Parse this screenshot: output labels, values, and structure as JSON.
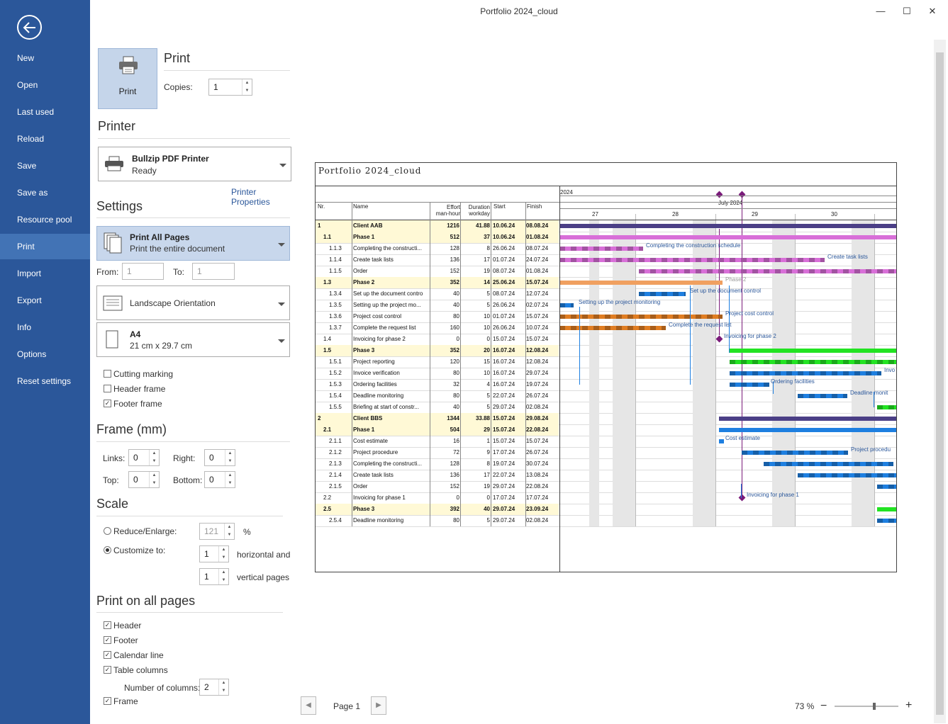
{
  "window": {
    "title": "Portfolio 2024_cloud",
    "minimize": "—",
    "maximize": "☐",
    "close": "✕"
  },
  "sidebar": {
    "items": [
      {
        "label": "New"
      },
      {
        "label": "Open"
      },
      {
        "label": "Last used"
      },
      {
        "label": "Reload"
      },
      {
        "label": "Save"
      },
      {
        "label": "Save as"
      },
      {
        "label": "Resource pool"
      },
      {
        "label": "Print"
      },
      {
        "label": "Import"
      },
      {
        "label": "Export"
      },
      {
        "label": "Info"
      },
      {
        "label": "Options"
      },
      {
        "label": "Reset settings"
      }
    ],
    "active": "Print"
  },
  "print": {
    "button_label": "Print",
    "heading": "Print",
    "copies_label": "Copies:",
    "copies_value": "1"
  },
  "printer": {
    "heading": "Printer",
    "name": "Bullzip PDF Printer",
    "status": "Ready",
    "properties_link": "Printer Properties"
  },
  "settings": {
    "heading": "Settings",
    "pages_title": "Print All Pages",
    "pages_sub": "Print the entire document",
    "from_label": "From:",
    "from_value": "1",
    "to_label": "To:",
    "to_value": "1",
    "orientation": "Landscape Orientation",
    "paper_title": "A4",
    "paper_sub": "21 cm x 29.7 cm",
    "cutting_marking": {
      "label": "Cutting marking",
      "checked": false
    },
    "header_frame": {
      "label": "Header frame",
      "checked": false
    },
    "footer_frame": {
      "label": "Footer frame",
      "checked": true
    }
  },
  "frame": {
    "heading": "Frame (mm)",
    "links_label": "Links:",
    "links_value": "0",
    "right_label": "Right:",
    "right_value": "0",
    "top_label": "Top:",
    "top_value": "0",
    "bottom_label": "Bottom:",
    "bottom_value": "0"
  },
  "scale": {
    "heading": "Scale",
    "reduce_label": "Reduce/Enlarge:",
    "reduce_value": "121",
    "percent": "%",
    "customize_label": "Customize to:",
    "horizontal_value": "1",
    "horizontal_label": "horizontal and",
    "vertical_value": "1",
    "vertical_label": "vertical pages",
    "mode": "customize"
  },
  "all_pages": {
    "heading": "Print on all pages",
    "header": {
      "label": "Header",
      "checked": true
    },
    "footer": {
      "label": "Footer",
      "checked": true
    },
    "calendar_line": {
      "label": "Calendar line",
      "checked": true
    },
    "table_columns": {
      "label": "Table columns",
      "checked": true
    },
    "number_of_columns_label": "Number of columns:",
    "number_of_columns_value": "2",
    "frame": {
      "label": "Frame",
      "checked": true
    }
  },
  "preview": {
    "page_title": "Portfolio 2024_cloud",
    "year": "2024",
    "month": "July 2024",
    "weeks": [
      "27",
      "28",
      "29",
      "30"
    ],
    "columns": {
      "nr": "Nr.",
      "name": "Name",
      "effort1": "Effort",
      "effort2": "man-hour",
      "duration1": "Duration",
      "duration2": "workday",
      "start": "Start",
      "finish": "Finish"
    },
    "rows": [
      {
        "nr": "1",
        "name": "Client AAB",
        "effort": "1216",
        "duration": "41.88",
        "start": "10.06.24",
        "finish": "08.08.24",
        "bold": true
      },
      {
        "nr": "1.1",
        "name": "Phase 1",
        "effort": "512",
        "duration": "37",
        "start": "10.06.24",
        "finish": "01.08.24",
        "bold": true
      },
      {
        "nr": "1.1.3",
        "name": "Completing the constructi...",
        "effort": "128",
        "duration": "8",
        "start": "26.06.24",
        "finish": "08.07.24"
      },
      {
        "nr": "1.1.4",
        "name": "Create task lists",
        "effort": "136",
        "duration": "17",
        "start": "01.07.24",
        "finish": "24.07.24"
      },
      {
        "nr": "1.1.5",
        "name": "Order",
        "effort": "152",
        "duration": "19",
        "start": "08.07.24",
        "finish": "01.08.24"
      },
      {
        "nr": "1.3",
        "name": "Phase 2",
        "effort": "352",
        "duration": "14",
        "start": "25.06.24",
        "finish": "15.07.24",
        "bold": true
      },
      {
        "nr": "1.3.4",
        "name": "Set up the document contro",
        "effort": "40",
        "duration": "5",
        "start": "08.07.24",
        "finish": "12.07.24"
      },
      {
        "nr": "1.3.5",
        "name": "Setting up the project mo...",
        "effort": "40",
        "duration": "5",
        "start": "26.06.24",
        "finish": "02.07.24"
      },
      {
        "nr": "1.3.6",
        "name": "Project cost control",
        "effort": "80",
        "duration": "10",
        "start": "01.07.24",
        "finish": "15.07.24"
      },
      {
        "nr": "1.3.7",
        "name": "Complete the request list",
        "effort": "160",
        "duration": "10",
        "start": "26.06.24",
        "finish": "10.07.24"
      },
      {
        "nr": "1.4",
        "name": "Invoicing for phase 2",
        "effort": "0",
        "duration": "0",
        "start": "15.07.24",
        "finish": "15.07.24"
      },
      {
        "nr": "1.5",
        "name": "Phase 3",
        "effort": "352",
        "duration": "20",
        "start": "16.07.24",
        "finish": "12.08.24",
        "bold": true
      },
      {
        "nr": "1.5.1",
        "name": "Project reporting",
        "effort": "120",
        "duration": "15",
        "start": "16.07.24",
        "finish": "12.08.24"
      },
      {
        "nr": "1.5.2",
        "name": "Invoice verification",
        "effort": "80",
        "duration": "10",
        "start": "16.07.24",
        "finish": "29.07.24"
      },
      {
        "nr": "1.5.3",
        "name": "Ordering facilities",
        "effort": "32",
        "duration": "4",
        "start": "16.07.24",
        "finish": "19.07.24"
      },
      {
        "nr": "1.5.4",
        "name": "Deadline monitoring",
        "effort": "80",
        "duration": "5",
        "start": "22.07.24",
        "finish": "26.07.24"
      },
      {
        "nr": "1.5.5",
        "name": "Briefing at start of constr...",
        "effort": "40",
        "duration": "5",
        "start": "29.07.24",
        "finish": "02.08.24"
      },
      {
        "nr": "2",
        "name": "Client BBS",
        "effort": "1344",
        "duration": "33.88",
        "start": "15.07.24",
        "finish": "29.08.24",
        "bold": true
      },
      {
        "nr": "2.1",
        "name": "Phase 1",
        "effort": "504",
        "duration": "29",
        "start": "15.07.24",
        "finish": "22.08.24",
        "bold": true
      },
      {
        "nr": "2.1.1",
        "name": "Cost estimate",
        "effort": "16",
        "duration": "1",
        "start": "15.07.24",
        "finish": "15.07.24"
      },
      {
        "nr": "2.1.2",
        "name": "Project procedure",
        "effort": "72",
        "duration": "9",
        "start": "17.07.24",
        "finish": "26.07.24"
      },
      {
        "nr": "2.1.3",
        "name": "Completing the constructi...",
        "effort": "128",
        "duration": "8",
        "start": "19.07.24",
        "finish": "30.07.24"
      },
      {
        "nr": "2.1.4",
        "name": "Create task lists",
        "effort": "136",
        "duration": "17",
        "start": "22.07.24",
        "finish": "13.08.24"
      },
      {
        "nr": "2.1.5",
        "name": "Order",
        "effort": "152",
        "duration": "19",
        "start": "29.07.24",
        "finish": "22.08.24"
      },
      {
        "nr": "2.2",
        "name": "Invoicing for phase 1",
        "effort": "0",
        "duration": "0",
        "start": "17.07.24",
        "finish": "17.07.24"
      },
      {
        "nr": "2.5",
        "name": "Phase 3",
        "effort": "392",
        "duration": "40",
        "start": "29.07.24",
        "finish": "23.09.24",
        "bold": true
      },
      {
        "nr": "2.5.4",
        "name": "Deadline monitoring",
        "effort": "80",
        "duration": "5",
        "start": "29.07.24",
        "finish": "02.08.24"
      }
    ],
    "bar_labels": [
      {
        "text": "Completing the construction schedule"
      },
      {
        "text": "Create task lists"
      },
      {
        "text": "Phase 2"
      },
      {
        "text": "Set up the document control"
      },
      {
        "text": "Setting up the project monitoring"
      },
      {
        "text": "Project cost control"
      },
      {
        "text": "Complete the request list"
      },
      {
        "text": "Invoicing for phase 2"
      },
      {
        "text": "Invo"
      },
      {
        "text": "Ordering facilities"
      },
      {
        "text": "Deadline monit"
      },
      {
        "text": "Cost estimate"
      },
      {
        "text": "Project procedu"
      },
      {
        "text": "Invoicing for phase 1"
      }
    ],
    "colors": {
      "summary": "#4b3f86",
      "phase1": "#d86fd8",
      "phase2": "#f0a060",
      "phase3": "#22e322",
      "task": "#1e7fe0",
      "orange_task": "#e07d22",
      "milestone": "#7a1b7a",
      "summary_row_bg": "#fff9d6",
      "sidebar": "#2b579a"
    }
  },
  "footer": {
    "page_label": "Page 1",
    "zoom": "73 %",
    "zoom_minus": "−",
    "zoom_plus": "+",
    "zoom_level_percent": 73
  }
}
